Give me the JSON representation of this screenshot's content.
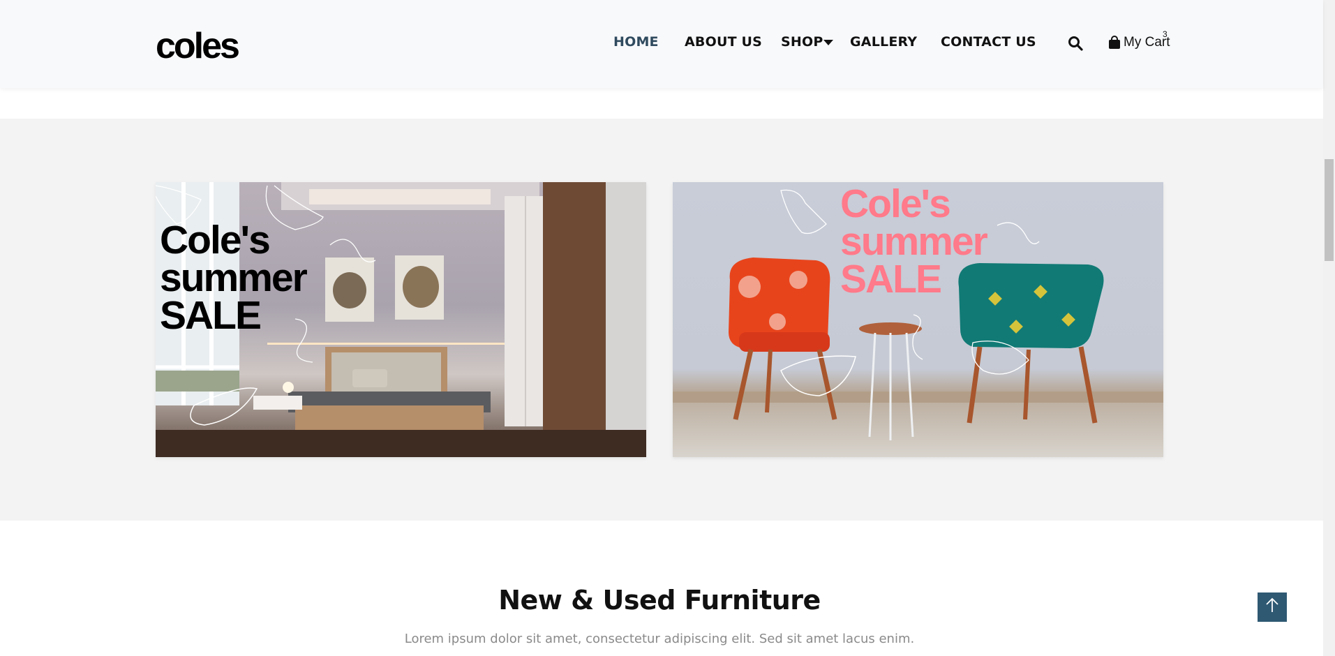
{
  "header": {
    "logo_text": "coles",
    "nav": [
      {
        "label": "HOME",
        "active": true
      },
      {
        "label": "ABOUT US",
        "active": false
      },
      {
        "label": "SHOP",
        "active": false
      },
      {
        "label": "GALLERY",
        "active": false
      },
      {
        "label": "CONTACT US",
        "active": false
      }
    ],
    "cart": {
      "label": "My Cart",
      "count": "3"
    },
    "icons": {
      "search": "search-icon",
      "cart": "shopping-bag-icon",
      "dropdown": "caret-down-icon"
    }
  },
  "banners": [
    {
      "line1": "Cole's",
      "line2": "summer",
      "line3": "SALE",
      "text_color": "#000000"
    },
    {
      "line1": "Cole's",
      "line2": "summer",
      "line3": "SALE",
      "text_color": "#ff7a8a"
    }
  ],
  "featured": {
    "title": "New & Used Furniture",
    "subtitle": "Lorem ipsum dolor sit amet, consectetur adipiscing elit. Sed sit amet lacus enim."
  },
  "back_to_top": {
    "icon": "arrow-up-icon"
  },
  "colors": {
    "accent": "#2f5973",
    "nav_active": "#2f4a5e",
    "section_bg": "#f3f3f3",
    "header_bg": "#f8f9fb"
  }
}
